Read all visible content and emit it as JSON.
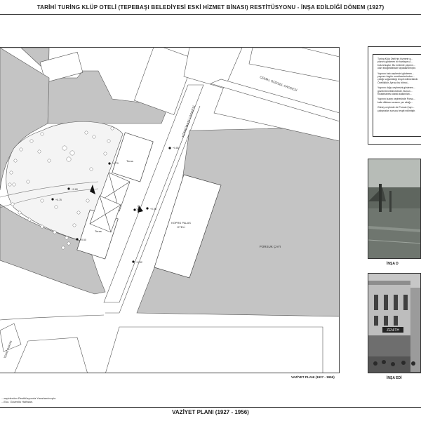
{
  "sheet": {
    "title": "TARİHİ TURİNG KLÜP OTELİ (TEPEBAŞI BELEDİYESİ ESKİ HİZMET BİNASI) RESTİTÜSYONU - İNŞA EDİLDİĞİ DÖNEM (1927)",
    "bottom_title": "VAZİYET PLANI (1927 - 1956)"
  },
  "plan": {
    "caption": "VAZİYET PLANI (1927 - 1956)",
    "labels": {
      "street_top": "CEMAL GÜRSEL CADDESİ",
      "street_diag": "KÖPRÜBAŞI CADDESİ",
      "street_left": "TENİS SOKAK",
      "hotel": "KÖPRÜ PALAS",
      "hotel2": "OTELİ",
      "river": "PORSUK ÇAYI",
      "teras_top": "Teras",
      "teras_bottom": "Teras"
    },
    "elevations": [
      "+0.80",
      "+0.70",
      "+0.60",
      "+0.75",
      "+0.50",
      "+0.55",
      "+0.52",
      "+0.40"
    ],
    "notes": [
      "...arşivlerden Restitüsyonda Yararlanılmıştır.",
      "...Eko. Güvenlik Haftaları."
    ]
  },
  "text_panel": {
    "paragraphs": [
      "Turing Klüp Oteli'nin hizmete g...\nplanını gösteren bir haritaya ul...\nbulunmuştur. Bu nedenle yapının...\nolan fotoğraflardan faydalanılmıştır.",
      "Yapının batı cephesini gösteren...\nyapının özgün merdivenlerinden...\nçıktığı soğanlıktığı tespit edilmektedir.\nÖzelliklidir. Ayrıca bu birinci...",
      "Yapının doğu cephesini gösteren...\ngözlemlenebilmektedir. Bunun...\nKiraathanesi olarak kullanılan...",
      "Yapının kuzey cephesinde Porsu...\nkafe dükkan scrasını yer aldığı...",
      "Güney cephede de Porsuk Çayı...\nçalışmaları sonucu tespit edilmiştir."
    ]
  },
  "photos": {
    "top_caption": "İNŞA D",
    "bottom_caption": "İNŞA EDİ",
    "sign_text": "ZENİTH"
  }
}
